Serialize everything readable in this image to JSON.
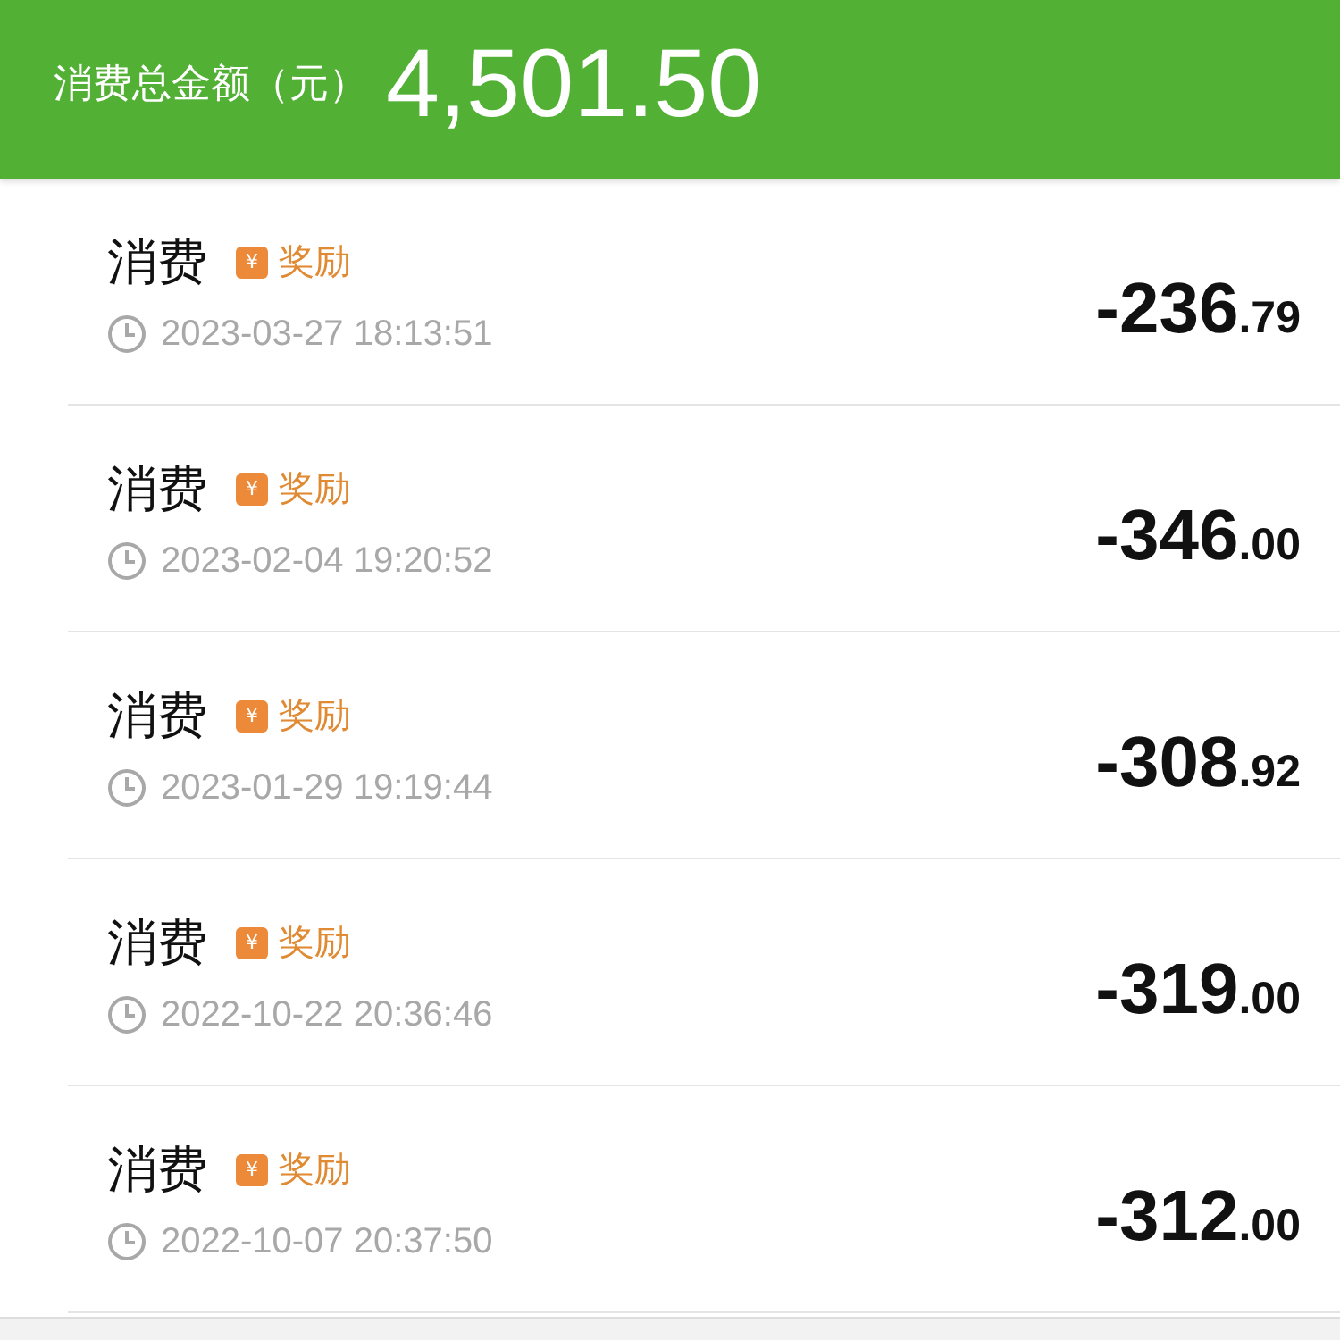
{
  "summary": {
    "label": "消费总金额（元）",
    "amount": "4,501.50"
  },
  "records": [
    {
      "title": "消费",
      "badge_icon": "¥",
      "badge": "奖励",
      "time": "2023-03-27 18:13:51",
      "amount_int": "-236",
      "amount_dec": ".79"
    },
    {
      "title": "消费",
      "badge_icon": "¥",
      "badge": "奖励",
      "time": "2023-02-04 19:20:52",
      "amount_int": "-346",
      "amount_dec": ".00"
    },
    {
      "title": "消费",
      "badge_icon": "¥",
      "badge": "奖励",
      "time": "2023-01-29 19:19:44",
      "amount_int": "-308",
      "amount_dec": ".92"
    },
    {
      "title": "消费",
      "badge_icon": "¥",
      "badge": "奖励",
      "time": "2022-10-22 20:36:46",
      "amount_int": "-319",
      "amount_dec": ".00"
    },
    {
      "title": "消费",
      "badge_icon": "¥",
      "badge": "奖励",
      "time": "2022-10-07 20:37:50",
      "amount_int": "-312",
      "amount_dec": ".00"
    }
  ]
}
